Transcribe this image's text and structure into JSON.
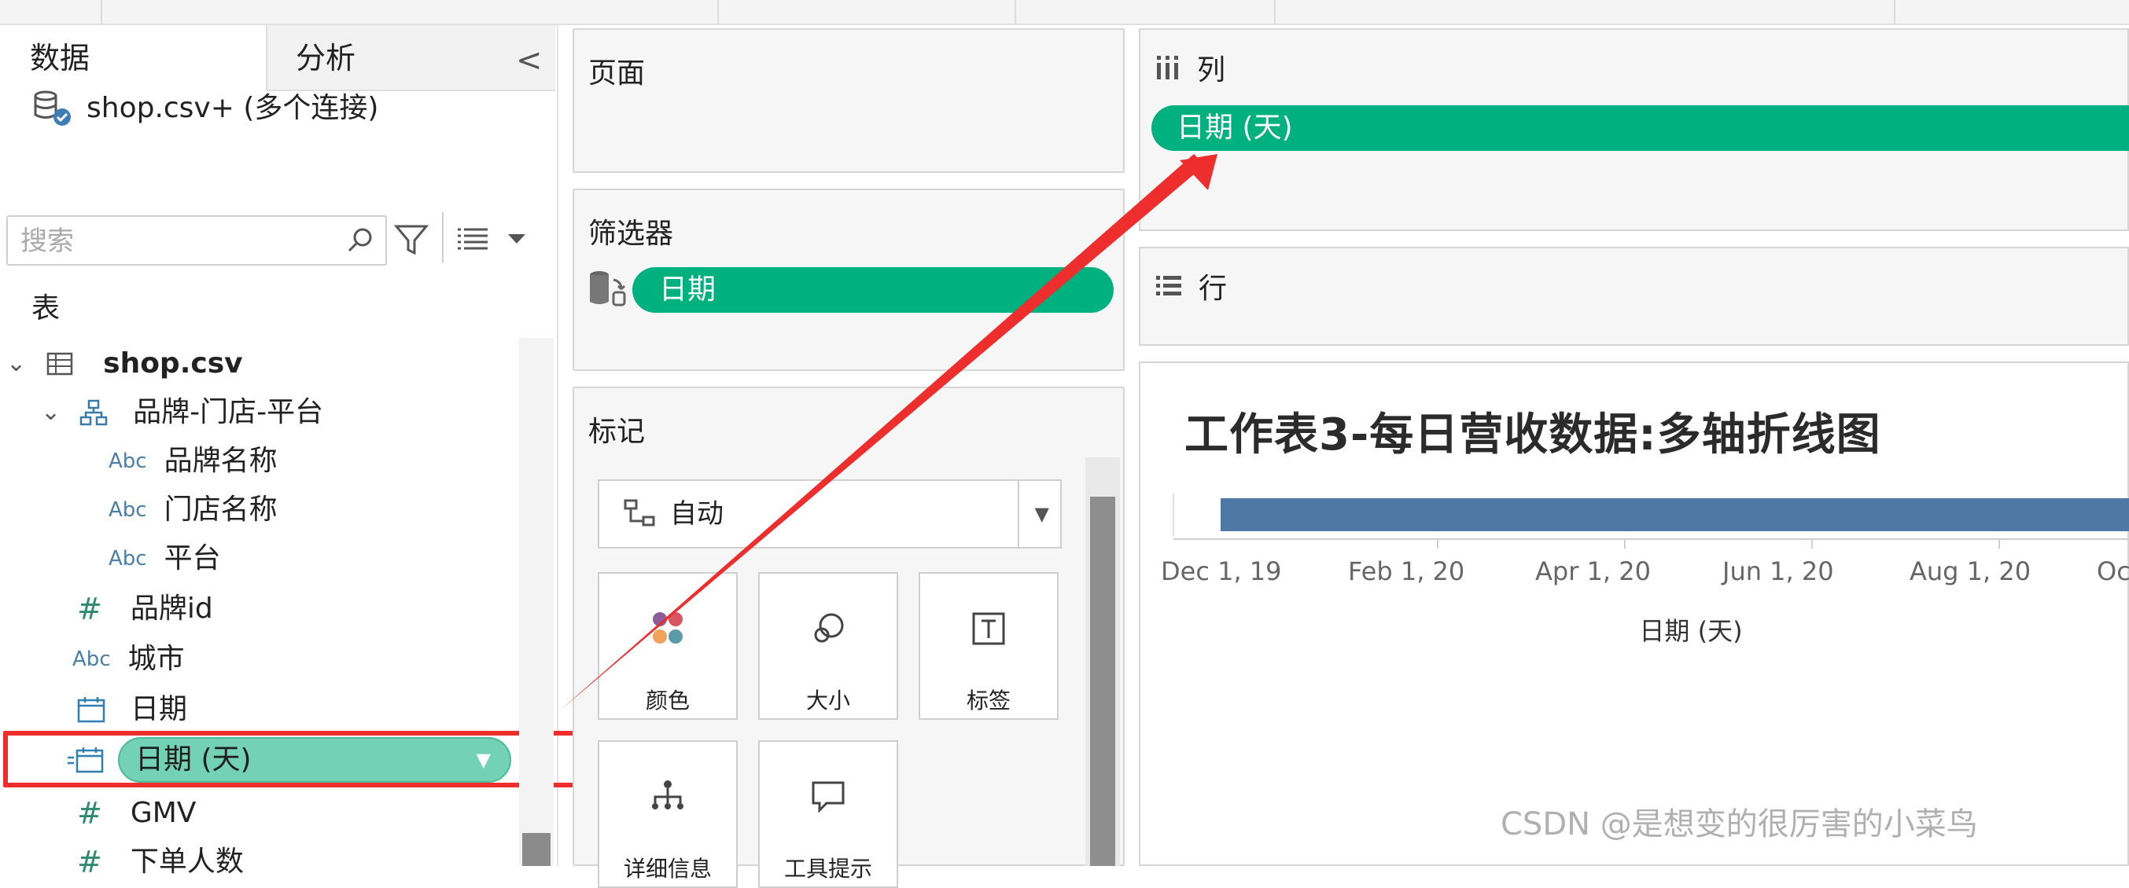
{
  "left_panel": {
    "tab_data": "数据",
    "tab_analysis": "分析",
    "collapse_glyph": "<",
    "connection": "shop.csv+ (多个连接)",
    "search_placeholder": "搜索",
    "section_tables": "表",
    "table_name": "shop.csv",
    "hierarchy_name": "品牌-门店-平台",
    "abc_label": "Abc",
    "hash_label": "#",
    "hierarchy_children": [
      "品牌名称",
      "门店名称",
      "平台"
    ],
    "fields": {
      "brand_id": "品牌id",
      "city": "城市",
      "date": "日期",
      "date_day": "日期 (天)",
      "gmv": "GMV",
      "order_users": "下单人数"
    }
  },
  "cards": {
    "pages": "页面",
    "filters": "筛选器",
    "filter_pill": "日期",
    "marks": "标记",
    "mark_type": "自动",
    "mark_buttons": [
      "颜色",
      "大小",
      "标签",
      "详细信息",
      "工具提示"
    ]
  },
  "shelves": {
    "columns_label": "列",
    "columns_pill": "日期 (天)",
    "rows_label": "行"
  },
  "worksheet": {
    "title": "工作表3-每日营收数据:多轴折线图",
    "axis_ticks": [
      "Dec 1, 19",
      "Feb 1, 20",
      "Apr 1, 20",
      "Jun 1, 20",
      "Aug 1, 20",
      "Oct"
    ],
    "axis_title": "日期 (天)"
  },
  "watermark": "CSDN @是想变的很厉害的小菜鸟",
  "colors": {
    "pill_green": "#00b180",
    "field_pill": "#72d2b3",
    "bar_blue": "#4e79a7",
    "highlight_red": "#ee2d2d"
  }
}
